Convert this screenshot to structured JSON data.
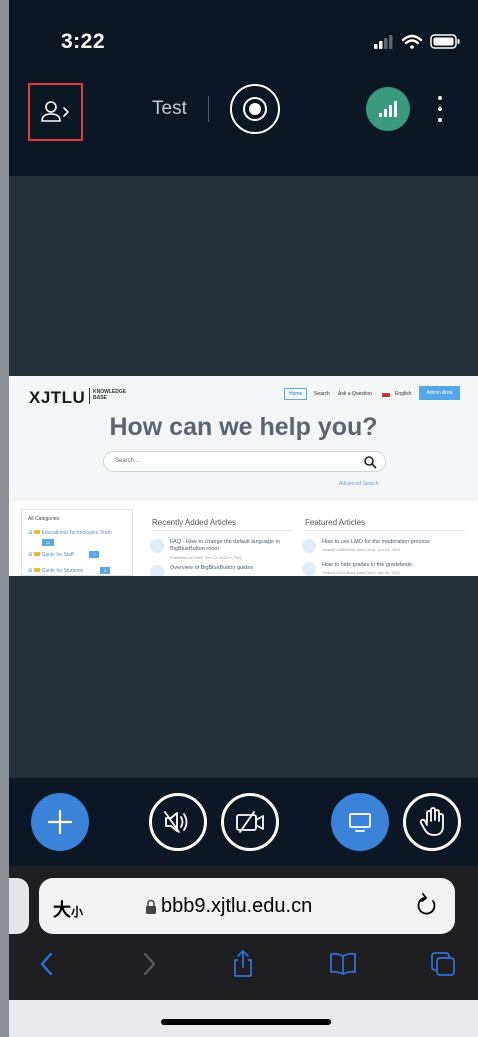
{
  "status_bar": {
    "time": "3:22"
  },
  "header": {
    "meeting_title": "Test"
  },
  "screenshare": {
    "logo": "XJTLU",
    "logo_sub_1": "KNOWLEDGE",
    "logo_sub_2": "BASE",
    "nav": [
      "Home",
      "Search",
      "Ask a Question",
      "English"
    ],
    "admin_button": "Admin Area",
    "hero": "How can we help you?",
    "search_placeholder": "Search...",
    "advanced_search": "Advanced Search",
    "categories_title": "All Categories",
    "categories": [
      {
        "label": "Educational Technologies Team",
        "badge": "11"
      },
      {
        "label": "Guide for Staff",
        "badge": "7"
      },
      {
        "label": "Guide for Students",
        "badge": "4"
      }
    ],
    "recent_title": "Recently Added Articles",
    "featured_title": "Featured Articles",
    "recent_articles": [
      {
        "title": "FAQ - How to change the default language in BigBlueButton room",
        "meta": "Published on Wed, Feb 23, 2022 in FAQ"
      },
      {
        "title": "Overview of BigBlueButton guides",
        "meta": ""
      }
    ],
    "featured_articles": [
      {
        "title": "How to use LMO for the moderation process",
        "meta": "Viewed 1358 times since Mon, Jun 21, 2021"
      },
      {
        "title": "How to hide grades in the gradebook",
        "meta": "Viewed 1524 times since Wed, Apr 28, 2021"
      }
    ]
  },
  "safari": {
    "text_size_label_big": "大",
    "text_size_label_small": "小",
    "host": "bbb9.xjtlu.edu.cn"
  },
  "colors": {
    "header_bg": "#0b1724",
    "content_bg": "#232e39",
    "primary_blue": "#3b82d9",
    "connection_green": "#3a9b7c",
    "highlight_red": "#e03a3a",
    "safari_link_blue": "#2f6fd6"
  }
}
